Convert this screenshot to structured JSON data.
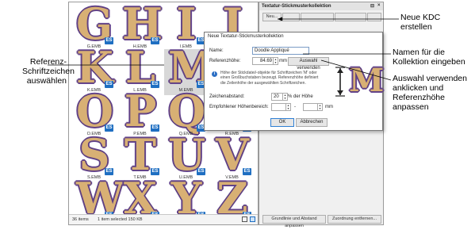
{
  "browser": {
    "thumbs": [
      {
        "letter": "G",
        "file": "G.EMB"
      },
      {
        "letter": "H",
        "file": "H.EMB"
      },
      {
        "letter": "I",
        "file": "I.EMB"
      },
      {
        "letter": "J",
        "file": ""
      },
      {
        "letter": "K",
        "file": "K.EMB"
      },
      {
        "letter": "L",
        "file": "L.EMB"
      },
      {
        "letter": "M",
        "file": "M.EMB"
      },
      {
        "letter": "N",
        "file": ""
      },
      {
        "letter": "O",
        "file": "O.EMB"
      },
      {
        "letter": "P",
        "file": "P.EMB"
      },
      {
        "letter": "Q",
        "file": "Q.EMB"
      },
      {
        "letter": "R",
        "file": "R.EMB"
      },
      {
        "letter": "S",
        "file": "S.EMB"
      },
      {
        "letter": "T",
        "file": "T.EMB"
      },
      {
        "letter": "U",
        "file": "U.EMB"
      },
      {
        "letter": "V",
        "file": "V.EMB"
      },
      {
        "letter": "W",
        "file": ""
      },
      {
        "letter": "X",
        "file": ""
      },
      {
        "letter": "Y",
        "file": ""
      },
      {
        "letter": "Z",
        "file": ""
      }
    ],
    "badge": "ES",
    "status_items": "36 items",
    "status_selected": "1 item selected  150 KB"
  },
  "docker": {
    "title": "Textatur-Stickmusterkollektion",
    "pin": "⊟",
    "close": "×",
    "new_button": "Neu...",
    "bottom_left": "Grundlinie und Abstand anpassen",
    "bottom_right": "Zuordnung entfernen..."
  },
  "dialog": {
    "title": "Neue Textatur-Stickmusterkollektion",
    "name_label": "Name:",
    "name_value": "Doodle Appliqué",
    "ref_height_label": "Referenzhöhe:",
    "ref_height_value": "84.69",
    "ref_unit": "mm",
    "use_selected_button": "Auswahl verwenden",
    "info_text": "Höhe der Stickdatei/-objekte für Schriftzeichen 'M' oder einen Großbuchstaben bezeugt. Referenzhöhe definiert die Zeilenhöhe der ausgewählten Schriftzeichen.",
    "spacing_label": "Zeichenabstand:",
    "spacing_value": "20",
    "spacing_unit": "% der Höhe",
    "recommended_label": "Empfohlener Höhenbereich:",
    "range_sep": "-",
    "range_unit": "mm",
    "ok_button": "OK",
    "cancel_button": "Abbrechen",
    "preview_letter": "M"
  },
  "callouts": {
    "ref_select": "Referenz-\nSchriftzeichen\nauswählen",
    "new_kdc": "Neue KDC\nerstellen",
    "name_collection": "Namen für die\nKollektion eingeben",
    "use_selection": "Auswahl verwenden\nanklicken und\nReferenzhöhe\nanpassen"
  },
  "colors": {
    "letter_fill": "#d8b074",
    "letter_outline": "#5c3f80",
    "badge": "#1f6fc2",
    "accent": "#2f7fd4"
  }
}
